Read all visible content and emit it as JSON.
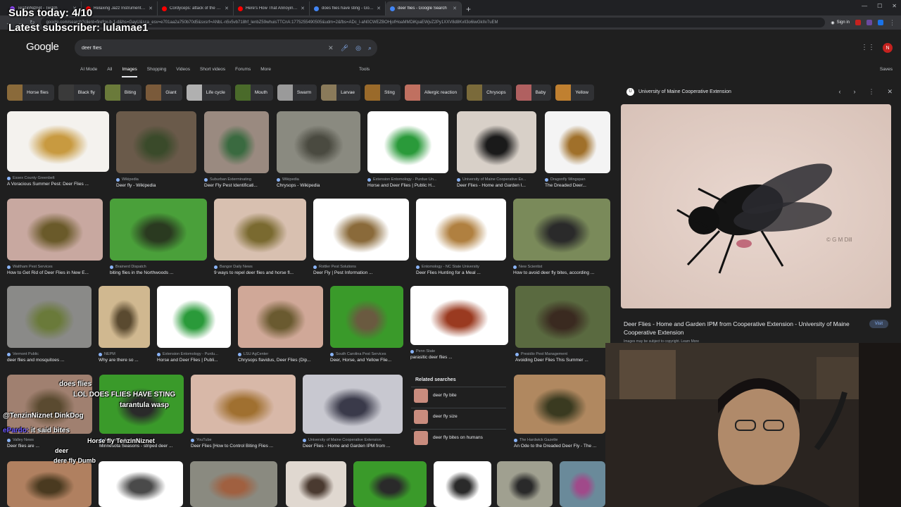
{
  "browser": {
    "tabs": [
      {
        "label": "TenzinNiznet - Twitch",
        "color": "#9146ff"
      },
      {
        "label": "Relaxing Jazz Instrumental Mu...",
        "color": "#ff0000"
      },
      {
        "label": "Cordyceps: attack of the killer f...",
        "color": "#ff0000"
      },
      {
        "label": "Here's How That Annoying Fly ...",
        "color": "#ff0000"
      },
      {
        "label": "does flies have sting - Google S...",
        "color": "#4285f4"
      },
      {
        "label": "deer flies - Google Search",
        "color": "#4285f4"
      }
    ],
    "new_tab": "+",
    "url": "google.com/search?client=firefox-b-1-d&hs=GayU&sca_esv=e701aa2a750b70d5&sxsrf=ANbL-n5v5vb718hf_lenbZ59whuisTTCnA:1775255490505&udm=2&fbs=ADc_l-aN0CWEZBOHjofHoaMMDiKpaEWjvZ2Py1XXV8d8KvlI3o6iwGkIIv7uEM",
    "signin": "Sign in"
  },
  "google": {
    "logo": "Google",
    "query": "deer flies",
    "tabs": [
      "AI Mode",
      "All",
      "Images",
      "Shopping",
      "Videos",
      "Short videos",
      "Forums",
      "More"
    ],
    "tools": "Tools",
    "saves": "Saves",
    "avatar": "N"
  },
  "chips": [
    {
      "label": "Horse flies",
      "color": "#8a6a3a"
    },
    {
      "label": "Black fly",
      "color": "#3a3a3a"
    },
    {
      "label": "Biting",
      "color": "#6a7a3a"
    },
    {
      "label": "Giant",
      "color": "#7a5a3a"
    },
    {
      "label": "Life cycle",
      "color": "#b0b0b0"
    },
    {
      "label": "Mouth",
      "color": "#4a6a2a"
    },
    {
      "label": "Swarm",
      "color": "#9a9a9a"
    },
    {
      "label": "Larvae",
      "color": "#8a7a5a"
    },
    {
      "label": "Sting",
      "color": "#9a6a2a"
    },
    {
      "label": "Allergic reaction",
      "color": "#c07060"
    },
    {
      "label": "Chrysops",
      "color": "#7a6a3a"
    },
    {
      "label": "Baby",
      "color": "#b06060"
    },
    {
      "label": "Yellow",
      "color": "#c08030"
    }
  ],
  "results": [
    {
      "src": "Essex County Greenbelt",
      "cap": "A Voracious Summer Pest: Deer Flies ...",
      "c1": "#f4f2ee",
      "c2": "#c89a40"
    },
    {
      "src": "Wikipedia",
      "cap": "Deer fly - Wikipedia",
      "c1": "#6a5a4a",
      "c2": "#3a4a2a"
    },
    {
      "src": "Suburban Exterminating",
      "cap": "Deer Fly Pest Identificati...",
      "c1": "#9a8a80",
      "c2": "#3a6a40"
    },
    {
      "src": "Wikipedia",
      "cap": "Chrysops - Wikipedia",
      "c1": "#8a8a80",
      "c2": "#4a4a40"
    },
    {
      "src": "Extension Entomology - Purdue Un...",
      "cap": "Horse and Deer Flies | Public H...",
      "c1": "#ffffff",
      "c2": "#2a9a3a"
    },
    {
      "src": "University of Maine Cooperative Ex...",
      "cap": "Deer Flies - Home and Garden I...",
      "c1": "#d8d0c8",
      "c2": "#1a1a1a"
    },
    {
      "src": "Dragonfly Wingspan",
      "cap": "The Dreaded Deer...",
      "c1": "#f4f4f4",
      "c2": "#a0702a"
    },
    {
      "src": "Waltham Pest Services",
      "cap": "How to Get Rid of Deer Flies in New E...",
      "c1": "#c8a8a0",
      "c2": "#6a5a2a"
    },
    {
      "src": "Brainerd Dispatch",
      "cap": "biting flies in the Northwoods ...",
      "c1": "#4aa03a",
      "c2": "#2a3a20"
    },
    {
      "src": "Bangor Daily News",
      "cap": "9 ways to repel deer flies and horse fl...",
      "c1": "#d8c0b0",
      "c2": "#7a6a30"
    },
    {
      "src": "Rottler Pest Solutions",
      "cap": "Deer Fly | Pest Information ...",
      "c1": "#ffffff",
      "c2": "#8a6a3a"
    },
    {
      "src": "Entomology - NC State University",
      "cap": "Deer Flies Hunting for a Meal ...",
      "c1": "#ffffff",
      "c2": "#b08040"
    },
    {
      "src": "New Scientist",
      "cap": "How to avoid deer fly bites, according ...",
      "c1": "#7a8a5a",
      "c2": "#2a2a2a"
    },
    {
      "src": "Vermont Public",
      "cap": "deer flies and mosquitoes ...",
      "c1": "#8a8a88",
      "c2": "#6a7a3a"
    },
    {
      "src": "NEPM",
      "cap": "Why are there so ...",
      "c1": "#d0b890",
      "c2": "#5a4a30"
    },
    {
      "src": "Extension Entomology - Purdu...",
      "cap": "Horse and Deer Flies | Publi...",
      "c1": "#ffffff",
      "c2": "#2a9a3a"
    },
    {
      "src": "LSU AgCenter",
      "cap": "Chrysops flavidus, Deer Flies (Dip...",
      "c1": "#d0a898",
      "c2": "#6a5a30"
    },
    {
      "src": "South Carolina Pest Services",
      "cap": "Deer, Horse, and Yellow Flie...",
      "c1": "#3a9a2a",
      "c2": "#6a5a40"
    },
    {
      "src": "Penn State",
      "cap": "parasitic deer flies ...",
      "c1": "#ffffff",
      "c2": "#9a3a20"
    },
    {
      "src": "Presidio Pest Management",
      "cap": "Avoiding Deer Flies This Summer ...",
      "c1": "#5a6a40",
      "c2": "#3a2a20"
    },
    {
      "src": "Valley News",
      "cap": "Deer flies are ...",
      "c1": "#a08070",
      "c2": "#5a4a30"
    },
    {
      "src": "Minnesota Seasons",
      "cap": "Minnesota Seasons - striped deer ...",
      "c1": "#3a9a2a",
      "c2": "#2a2a2a"
    },
    {
      "src": "YouTube",
      "cap": "Deer Flies [How to Control Biting Flies ...",
      "c1": "#d8b8a8",
      "c2": "#a07030"
    },
    {
      "src": "University of Maine Cooperative Extension",
      "cap": "Deer Flies - Home and Garden IPM from ...",
      "c1": "#c8c8d0",
      "c2": "#3a3a4a"
    },
    {
      "src": "The Hardwick Gazette",
      "cap": "An Ode to the Dreaded Deer Fly - The ...",
      "c1": "#b08860",
      "c2": "#3a3a20"
    },
    {
      "src": "",
      "cap": "",
      "c1": "#b08060",
      "c2": "#4a3a20"
    },
    {
      "src": "",
      "cap": "",
      "c1": "#ffffff",
      "c2": "#4a4a4a"
    },
    {
      "src": "",
      "cap": "",
      "c1": "#8a8a80",
      "c2": "#a06040"
    },
    {
      "src": "",
      "cap": "",
      "c1": "#e0d8d0",
      "c2": "#4a3a30"
    },
    {
      "src": "",
      "cap": "",
      "c1": "#3a9a2a",
      "c2": "#2a2a2a"
    },
    {
      "src": "",
      "cap": "",
      "c1": "#ffffff",
      "c2": "#2a2a2a"
    },
    {
      "src": "",
      "cap": "",
      "c1": "#a0a090",
      "c2": "#2a2a2a"
    },
    {
      "src": "",
      "cap": "",
      "c1": "#6a8a9a",
      "c2": "#a04a8a"
    }
  ],
  "related": {
    "title": "Related searches",
    "items": [
      "deer fly bite",
      "deer fly size",
      "deer fly bites on humans"
    ]
  },
  "panel": {
    "source": "University of Maine Cooperative Extension",
    "title": "Deer Flies - Home and Garden IPM from Cooperative Extension - University of Maine Cooperative Extension",
    "visit": "Visit",
    "note": "Images may be subject to copyright. Learn More",
    "watermark": "© G M Dill"
  },
  "stream": {
    "subs": "Subs today: 4/10",
    "latest": "Latest subscriber: lulamae1",
    "chat": [
      {
        "name": "",
        "msg": "does flies"
      },
      {
        "name": "",
        "msg": "LOL DOES FLIES HAVE STING"
      },
      {
        "name": "",
        "msg": "tarantula wasp"
      },
      {
        "name": "",
        "msg": "@TenzinNiznet DinkDog"
      },
      {
        "name": "ePardo:",
        "msg": "it said bites"
      },
      {
        "name": "",
        "msg": "Horse fly TenzinNiznet"
      },
      {
        "name": "",
        "msg": "deer"
      },
      {
        "name": "",
        "msg": "dere fly Dumb"
      }
    ]
  }
}
